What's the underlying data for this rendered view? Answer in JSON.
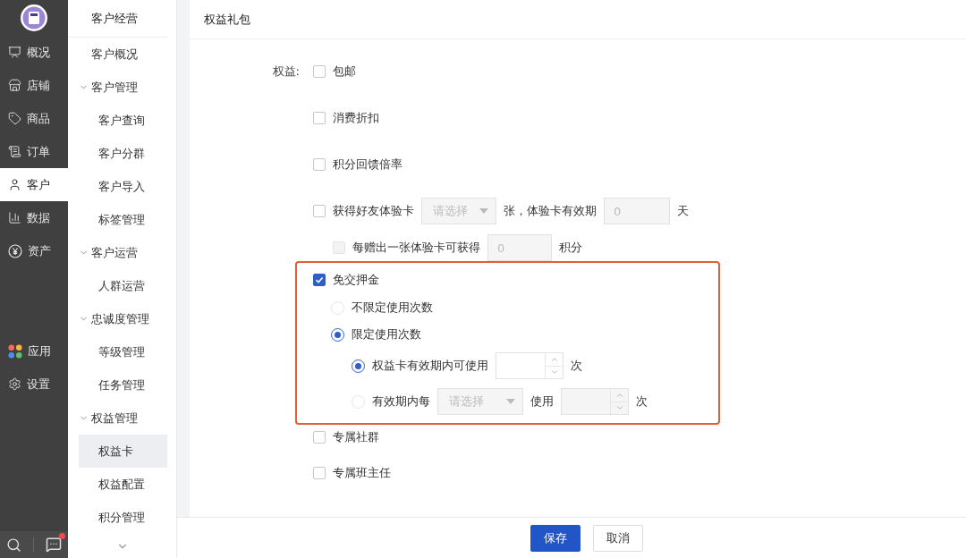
{
  "nav_rail": {
    "items": [
      {
        "label": "概况",
        "selected": false
      },
      {
        "label": "店铺",
        "selected": false
      },
      {
        "label": "商品",
        "selected": false
      },
      {
        "label": "订单",
        "selected": false
      },
      {
        "label": "客户",
        "selected": true
      },
      {
        "label": "数据",
        "selected": false
      },
      {
        "label": "资产",
        "selected": false
      }
    ],
    "bottom_items": [
      {
        "label": "应用",
        "selected": false
      },
      {
        "label": "设置",
        "selected": false
      }
    ],
    "footer": {
      "unread": true
    }
  },
  "submenu": {
    "title": "客户经营",
    "items": [
      {
        "label": "客户概况",
        "selected": false
      },
      {
        "label": "客户管理",
        "expanded": true,
        "children": [
          {
            "label": "客户查询",
            "selected": false
          },
          {
            "label": "客户分群",
            "selected": false
          },
          {
            "label": "客户导入",
            "selected": false
          },
          {
            "label": "标签管理",
            "selected": false
          }
        ]
      },
      {
        "label": "客户运营",
        "expanded": true,
        "children": [
          {
            "label": "人群运营",
            "selected": false
          }
        ]
      },
      {
        "label": "忠诚度管理",
        "expanded": true,
        "children": [
          {
            "label": "等级管理",
            "selected": false
          },
          {
            "label": "任务管理",
            "selected": false
          }
        ]
      },
      {
        "label": "权益管理",
        "expanded": true,
        "children": [
          {
            "label": "权益卡",
            "selected": true
          },
          {
            "label": "权益配置",
            "selected": false
          },
          {
            "label": "积分管理",
            "selected": false
          }
        ]
      }
    ]
  },
  "main": {
    "section_title": "权益礼包",
    "field_label": "权益:",
    "benefits": [
      {
        "kind": "simple",
        "label": "包邮",
        "checked": false
      },
      {
        "kind": "simple",
        "label": "消费折扣",
        "checked": false
      },
      {
        "kind": "simple",
        "label": "积分回馈倍率",
        "checked": false
      },
      {
        "kind": "trial_card",
        "label": "获得好友体验卡",
        "checked": false,
        "select_placeholder": "请选择",
        "middle_text": "张，体验卡有效期",
        "days_value": "0",
        "days_unit": "天",
        "sub": {
          "label": "每赠出一张体验卡可获得",
          "checked": false,
          "disabled": true,
          "points_value": "0",
          "points_unit": "积分"
        }
      },
      {
        "kind": "deposit",
        "label": "免交押金",
        "checked": true,
        "highlighted": true,
        "options": [
          {
            "label": "不限定使用次数",
            "selected": false
          },
          {
            "label": "限定使用次数",
            "selected": true,
            "sub_options": [
              {
                "kind": "count",
                "label": "权益卡有效期内可使用",
                "selected": true,
                "unit": "次"
              },
              {
                "kind": "period",
                "label": "有效期内每",
                "selected": false,
                "select_placeholder": "请选择",
                "middle_text": "使用",
                "unit": "次"
              }
            ]
          }
        ]
      },
      {
        "kind": "simple",
        "label": "专属社群",
        "checked": false
      },
      {
        "kind": "simple",
        "label": "专属班主任",
        "checked": false
      }
    ]
  },
  "buttons": [
    {
      "label": "保存",
      "kind": "primary"
    },
    {
      "label": "取消",
      "kind": "default"
    }
  ]
}
